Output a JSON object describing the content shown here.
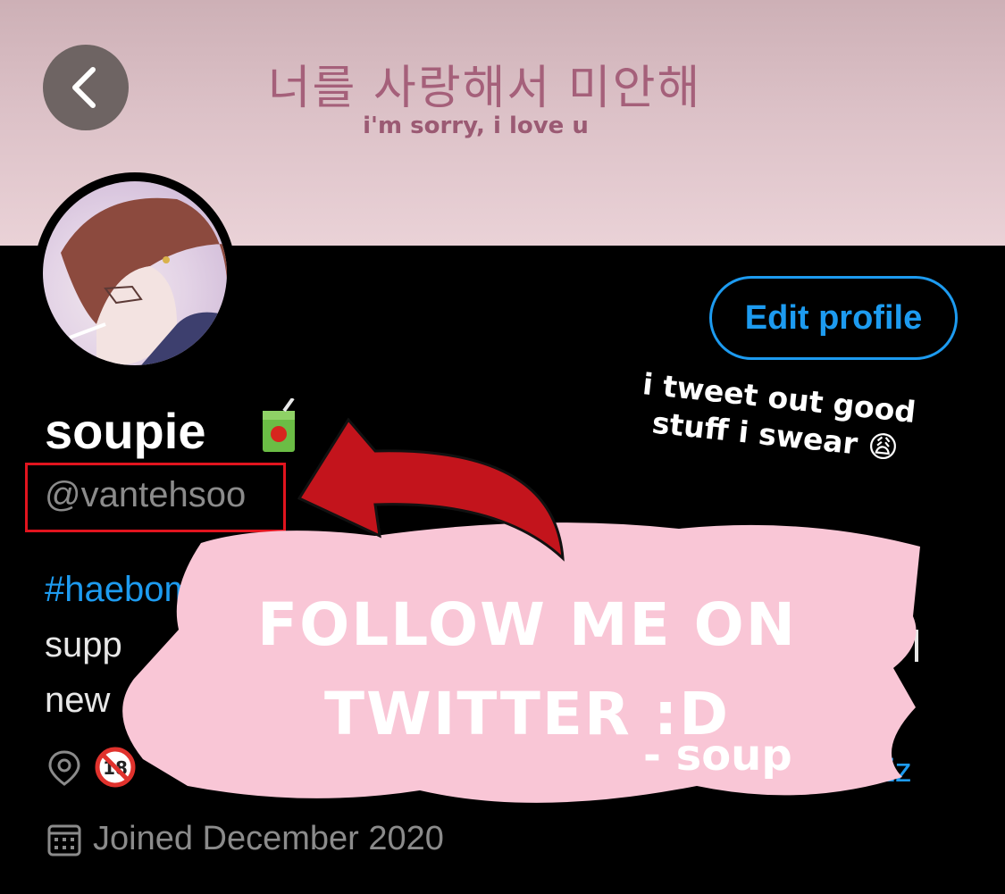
{
  "header": {
    "banner_title": "너를 사랑해서 미안해",
    "banner_subtitle": "i'm sorry, i love u"
  },
  "profile": {
    "display_name": "soupie",
    "name_emoji": "juice-box-icon",
    "handle": "@vantehsoo",
    "edit_button_label": "Edit profile",
    "bio": {
      "hashtag": "#haebom.",
      "line2_start": "supp",
      "line3_start": "new"
    },
    "location_emoji": "no-one-under-18-icon",
    "link_fragment": "9NZz",
    "joined": "Joined December 2020"
  },
  "overlay": {
    "note": "i tweet out good stuff i swear 😩",
    "follow_text": "FOLLOW ME ON TWITTER :D",
    "signature": "- soup"
  },
  "colors": {
    "accent": "#1d9bf0",
    "highlight_box": "#e1141e",
    "arrow": "#c3141c",
    "brush": "#f9c6d6",
    "banner": "#dcc1c7"
  }
}
